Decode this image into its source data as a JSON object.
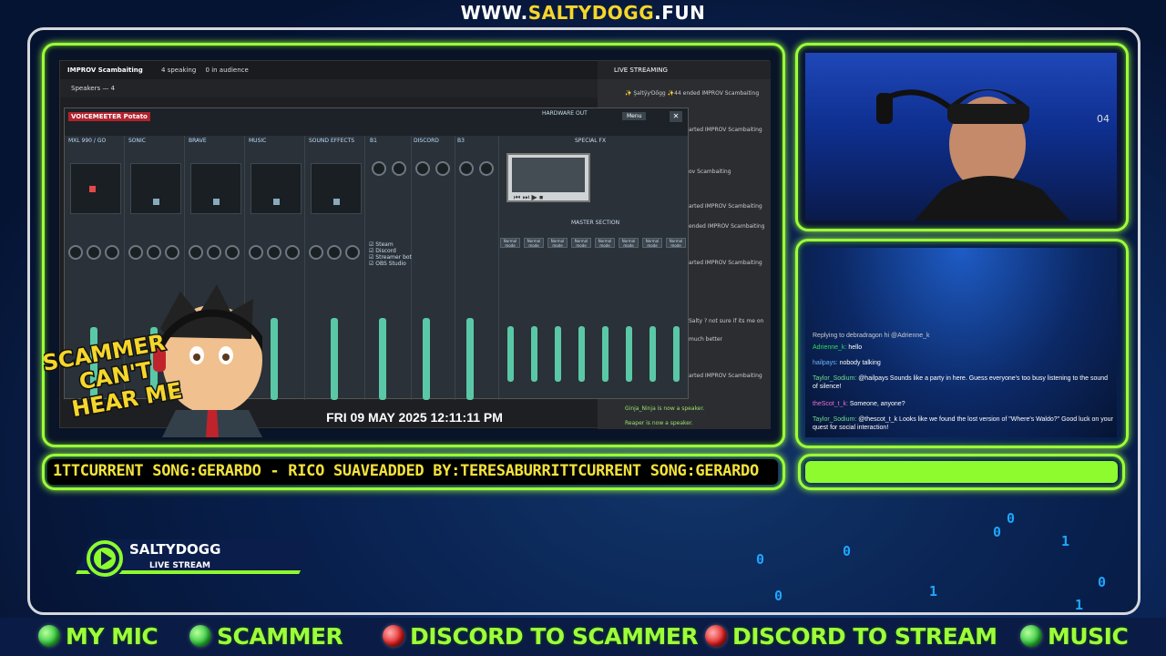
{
  "site_url": {
    "prefix": "WWW.",
    "domain": "SALTYDOGG",
    "suffix": ".FUN"
  },
  "discord": {
    "channel": "IMPROV Scambaiting",
    "speaking": "4 speaking",
    "audience": "0 in audience",
    "speakers_label": "Speakers — 4",
    "panel_title": "LIVE STREAMING",
    "events": [
      {
        "text": "✨ ŞaltÿƴDőgg ✨44 ended IMPROV Scambaiting"
      },
      {
        "text": "arted IMPROV Scambaiting"
      },
      {
        "text": "ended IMPROV Scambaiting"
      },
      {
        "text": "ov Scambaiting"
      },
      {
        "text": "arted IMPROV Scambaiting"
      },
      {
        "text": "ended IMPROV Scambaiting"
      },
      {
        "text": "arted IMPROV Scambaiting"
      },
      {
        "text": "Salty ? not sure if its me on"
      },
      {
        "text": "much better"
      },
      {
        "text": "arted IMPROV Scambaiting"
      },
      {
        "text": "Ginja_Ninja is now a speaker."
      },
      {
        "text": "Reaper is now a speaker."
      }
    ]
  },
  "voicemeeter": {
    "title": "VOICEMEETER Potato",
    "strips": [
      "MXL 990 / GO",
      "SONIC",
      "BRAVE",
      "MUSIC",
      "SOUND EFFECTS"
    ],
    "strip_levels": [
      0.45,
      0.4,
      0.35,
      0.55,
      0.6
    ],
    "buses": [
      "B1",
      "DISCORD",
      "B3"
    ],
    "bus_levels": [
      0.6,
      0.7,
      0.55
    ],
    "hardware_out": "HARDWARE OUT",
    "menu": "Menu",
    "special_fx": "SPECIAL FX",
    "master_section": "MASTER SECTION",
    "virtual_inputs": [
      {
        "name": "Steam"
      },
      {
        "name": "Discord"
      },
      {
        "name": "Streamer bot"
      },
      {
        "name": "OBS Studio"
      }
    ],
    "master_channels": [
      "Normal mode",
      "Normal mode",
      "Normal mode",
      "Normal mode",
      "Normal mode",
      "Normal mode",
      "Normal mode",
      "Normal mode"
    ],
    "master_levels": [
      0.55,
      0.55,
      0.55,
      0.55,
      0.55,
      0.55,
      0.55,
      0.55
    ]
  },
  "mascot": {
    "line1": "SCAMMER",
    "line2": "CAN'T",
    "line3": "HEAR ME"
  },
  "datetime": "FRI 09 MAY 2025 12:11:11 PM",
  "chat": [
    {
      "user": "",
      "text": "Replying to debradragon hi @Adrienne_k"
    },
    {
      "user": "Adrienne_k:",
      "text": "hello",
      "color": "u1"
    },
    {
      "user": "hailpays:",
      "text": "nobody talking",
      "color": "u2"
    },
    {
      "user": "Taylor_Sodium:",
      "text": "@hailpays Sounds like a party in here. Guess everyone's too busy listening to the sound of silence!",
      "color": "u4"
    },
    {
      "user": "theScot_t_k:",
      "text": "Someone, anyone?",
      "color": "u3"
    },
    {
      "user": "Taylor_Sodium:",
      "text": "@thescot_t_k Looks like we found the lost version of \"Where's Waldo?\" Good luck on your quest for social interaction!",
      "color": "u4"
    }
  ],
  "ticker": "1TTCURRENT SONG:GERARDO - RICO SUAVEADDED BY:TERESABURRITTCURRENT SONG:GERARDO",
  "logo": {
    "name": "SALTYDOGG",
    "sub": "LIVE STREAM"
  },
  "indicators": [
    {
      "label": "MY MIC",
      "state": "green"
    },
    {
      "label": "SCAMMER",
      "state": "green"
    },
    {
      "label": "DISCORD TO SCAMMER",
      "state": "red"
    },
    {
      "label": "DISCORD TO STREAM",
      "state": "red"
    },
    {
      "label": "MUSIC",
      "state": "green"
    }
  ],
  "colors": {
    "accent": "#9cff3a",
    "ticker_text": "#f3e33a",
    "domain": "#f5d62a"
  }
}
